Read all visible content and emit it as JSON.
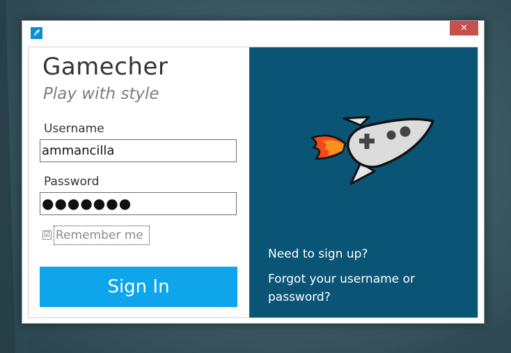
{
  "window": {
    "close_symbol": "✕",
    "app_icon": "feather-icon"
  },
  "login": {
    "title": "Gamecher",
    "tagline": "Play with style",
    "username_label": "Username",
    "username_value": "ammancilla",
    "password_label": "Password",
    "password_masked": "●●●●●●●",
    "remember_label": "Remember me",
    "remember_checked": true,
    "remember_check_mark": "☑",
    "signin_label": "Sign In"
  },
  "side_panel": {
    "illustration": "rocket-gamepad-icon",
    "signup_link": "Need to sign up?",
    "forgot_link": "Forgot your username or password?"
  },
  "colors": {
    "accent": "#0ea5ea",
    "panel": "#0a5576",
    "close": "#c7504b"
  }
}
